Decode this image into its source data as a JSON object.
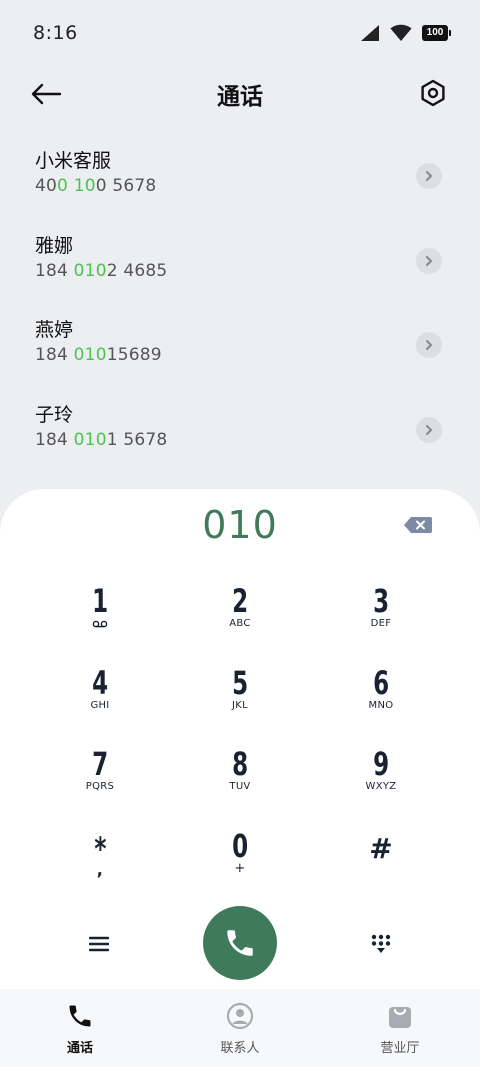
{
  "status_bar": {
    "time": "8:16",
    "battery": "100"
  },
  "header": {
    "title": "通话"
  },
  "contacts": [
    {
      "name": "小米客服",
      "number_parts": [
        "40",
        "0",
        " ",
        "10",
        "0 5678"
      ]
    },
    {
      "name": "雅娜",
      "number_parts": [
        "184 ",
        "010",
        "",
        "",
        "2 4685"
      ]
    },
    {
      "name": "燕婷",
      "number_parts": [
        "184 ",
        "010",
        "",
        "",
        "15689"
      ]
    },
    {
      "name": "子玲",
      "number_parts": [
        "184 ",
        "010",
        "",
        "",
        "1 5678"
      ]
    }
  ],
  "dialer": {
    "dialed": "010",
    "keys": [
      {
        "digit": "1",
        "letters": ""
      },
      {
        "digit": "2",
        "letters": "ABC"
      },
      {
        "digit": "3",
        "letters": "DEF"
      },
      {
        "digit": "4",
        "letters": "GHI"
      },
      {
        "digit": "5",
        "letters": "JKL"
      },
      {
        "digit": "6",
        "letters": "MNO"
      },
      {
        "digit": "7",
        "letters": "PQRS"
      },
      {
        "digit": "8",
        "letters": "TUV"
      },
      {
        "digit": "9",
        "letters": "WXYZ"
      },
      {
        "digit": "*",
        "letters": ","
      },
      {
        "digit": "0",
        "letters": "+"
      },
      {
        "digit": "#",
        "letters": ""
      }
    ]
  },
  "tabs": [
    {
      "label": "通话",
      "icon": "phone-icon",
      "active": true
    },
    {
      "label": "联系人",
      "icon": "person-icon",
      "active": false
    },
    {
      "label": "营业厅",
      "icon": "shopping-bag-icon",
      "active": false
    }
  ],
  "colors": {
    "accent": "#3f7a5b",
    "highlight": "#4cc34d"
  }
}
